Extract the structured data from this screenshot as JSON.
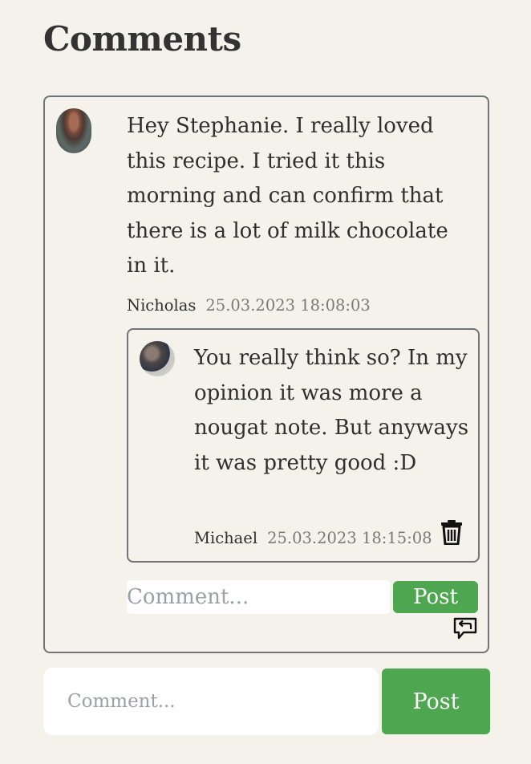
{
  "page": {
    "heading": "Comments"
  },
  "comment": {
    "text": "Hey Stephanie. I really loved this recipe. I tried it this morning and can confirm that there is a lot of milk chocolate in it.",
    "author": "Nicholas",
    "timestamp": "25.03.2023 18:08:03",
    "avatar_icon": "user-avatar-icon",
    "reply": {
      "text": "You really think so? In my opinion it was more a nougat note. But anyways it was pretty good :D",
      "author": "Michael",
      "timestamp": "25.03.2023 18:15:08",
      "avatar_icon": "user-avatar-icon",
      "delete_icon": "trash-icon"
    },
    "reply_form": {
      "placeholder": "Comment...",
      "value": "",
      "post_label": "Post",
      "reply_icon": "reply-icon"
    }
  },
  "new_comment": {
    "placeholder": "Comment...",
    "value": "",
    "post_label": "Post"
  },
  "colors": {
    "background": "#f4f2eb",
    "accent": "#4ea651",
    "border": "#6f7479",
    "timestamp": "#7a7a7a"
  }
}
